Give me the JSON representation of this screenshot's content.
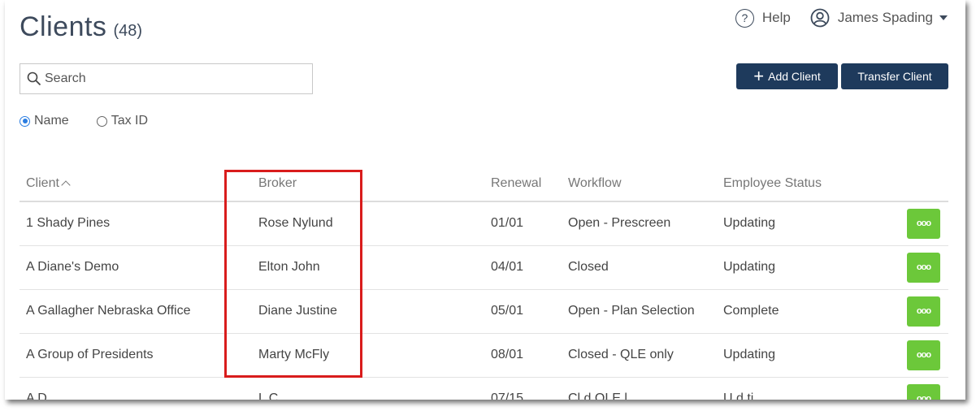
{
  "header": {
    "title": "Clients",
    "count": "(48)",
    "help_label": "Help",
    "user_name": "James Spading"
  },
  "search": {
    "placeholder": "Search"
  },
  "toolbar": {
    "add_label": "Add Client",
    "transfer_label": "Transfer Client"
  },
  "filter": {
    "options": [
      {
        "label": "Name",
        "checked": true
      },
      {
        "label": "Tax ID",
        "checked": false
      }
    ]
  },
  "table": {
    "columns": [
      "Client",
      "Broker",
      "Renewal",
      "Workflow",
      "Employee Status"
    ],
    "rows": [
      {
        "client": "1 Shady Pines",
        "broker": "Rose Nylund",
        "renewal": "01/01",
        "workflow": "Open - Prescreen",
        "status": "Updating"
      },
      {
        "client": "A Diane's Demo",
        "broker": "Elton John",
        "renewal": "04/01",
        "workflow": "Closed",
        "status": "Updating"
      },
      {
        "client": "A Gallagher Nebraska Office",
        "broker": "Diane Justine",
        "renewal": "05/01",
        "workflow": "Open - Plan Selection",
        "status": "Complete"
      },
      {
        "client": "A Group of Presidents",
        "broker": "Marty McFly",
        "renewal": "08/01",
        "workflow": "Closed - QLE only",
        "status": "Updating"
      },
      {
        "client": "A D",
        "broker": "L    C",
        "renewal": "07/15",
        "workflow": "Cl    d   QLE   l",
        "status": "U  d  ti"
      }
    ]
  },
  "colors": {
    "primary_button": "#1e3a5c",
    "action_button": "#6cc83a",
    "highlight_box": "#d91c1c",
    "radio_selected": "#2a7de1"
  }
}
